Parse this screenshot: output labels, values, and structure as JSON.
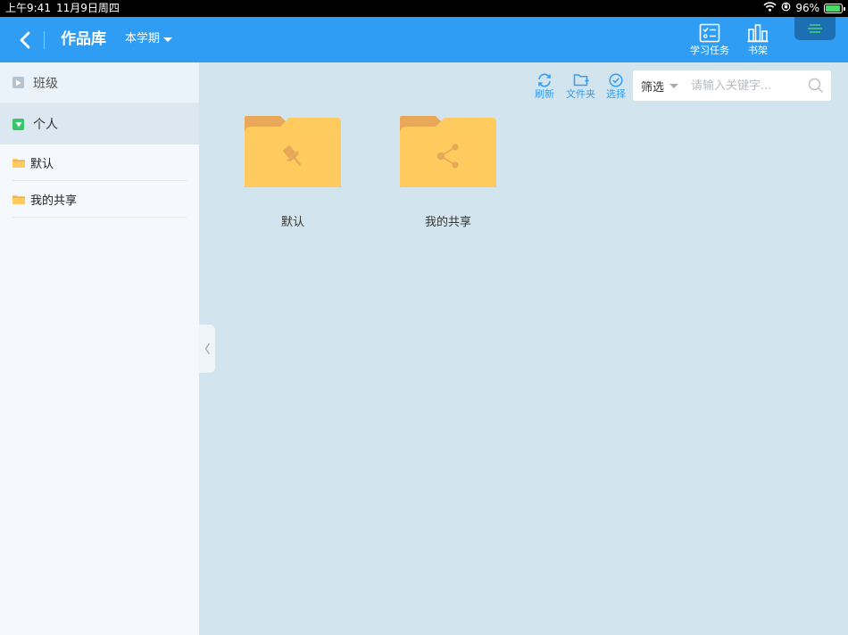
{
  "status_bar": {
    "time": "上午9:41",
    "date": "11月9日周四",
    "battery": "96%",
    "battery_level": 0.96
  },
  "header": {
    "title": "作品库",
    "semester_label": "本学期",
    "task_label": "学习任务",
    "shelf_label": "书架"
  },
  "sidebar": {
    "groups": [
      {
        "label": "班级",
        "expanded": false
      },
      {
        "label": "个人",
        "expanded": true
      }
    ],
    "items": [
      {
        "label": "默认"
      },
      {
        "label": "我的共享"
      }
    ]
  },
  "toolbar": {
    "refresh_label": "刷新",
    "folder_label": "文件夹",
    "select_label": "选择",
    "filter_label": "筛选",
    "search_placeholder": "请输入关键字..."
  },
  "folders": [
    {
      "name": "默认",
      "icon": "pin-icon"
    },
    {
      "name": "我的共享",
      "icon": "share-icon"
    }
  ],
  "colors": {
    "header_blue": "#2f9df4",
    "folder_yellow": "#ffcb5e",
    "folder_tab": "#e9a75a",
    "content_bg": "#d2e5ee",
    "sidebar_bg": "#f5f9fd"
  }
}
